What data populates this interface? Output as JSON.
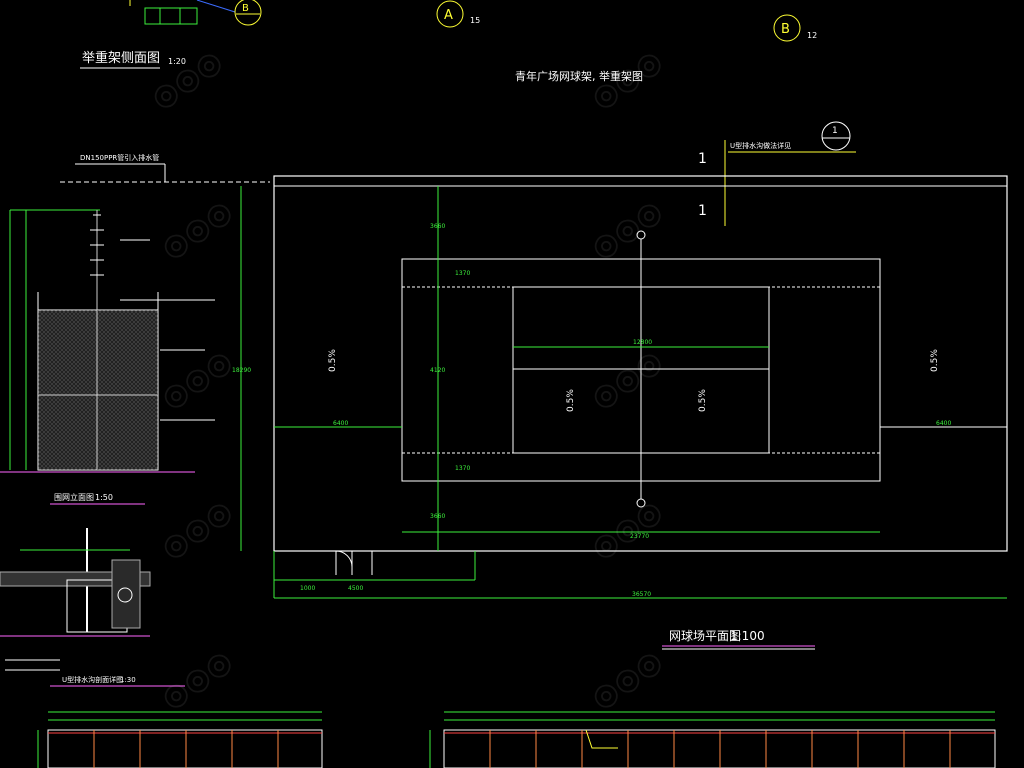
{
  "callouts": {
    "top_left": {
      "letter": "B"
    },
    "top_a": {
      "letter": "A",
      "num": "15"
    },
    "top_b": {
      "letter": "B",
      "num": "12"
    },
    "section": {
      "top": "1",
      "bottom": "—"
    }
  },
  "titles": {
    "side_view": "举重架侧面图",
    "side_view_scale": "1:20",
    "main_plan": "青年广场网球架, 举重架图",
    "court_plan": "网球场平面图",
    "court_plan_scale": "1:100",
    "net_elevation": "围网立面图",
    "net_elevation_scale": "1:50",
    "foundation_section": "U型排水沟剖面详图",
    "foundation_scale": "1:30"
  },
  "labels": {
    "pipe": "DN150PPR管引入排水管",
    "u_channel": "U型排水沟做法详见",
    "section_mark_top": "1",
    "section_mark_bottom": "1"
  },
  "slopes": {
    "left": "0.5%",
    "right": "0.5%",
    "inner_left": "0.5%",
    "inner_right": "0.5%"
  },
  "dims": {
    "net": "12800",
    "inner_width": "23770",
    "total": "36570",
    "side_left": "6400",
    "side_right": "6400",
    "top_off": "3660",
    "bot_off": "3660",
    "service_top": "1370",
    "service_bot": "1370",
    "half": "4120",
    "height": "18290",
    "b1": "1000",
    "b2": "4500"
  }
}
